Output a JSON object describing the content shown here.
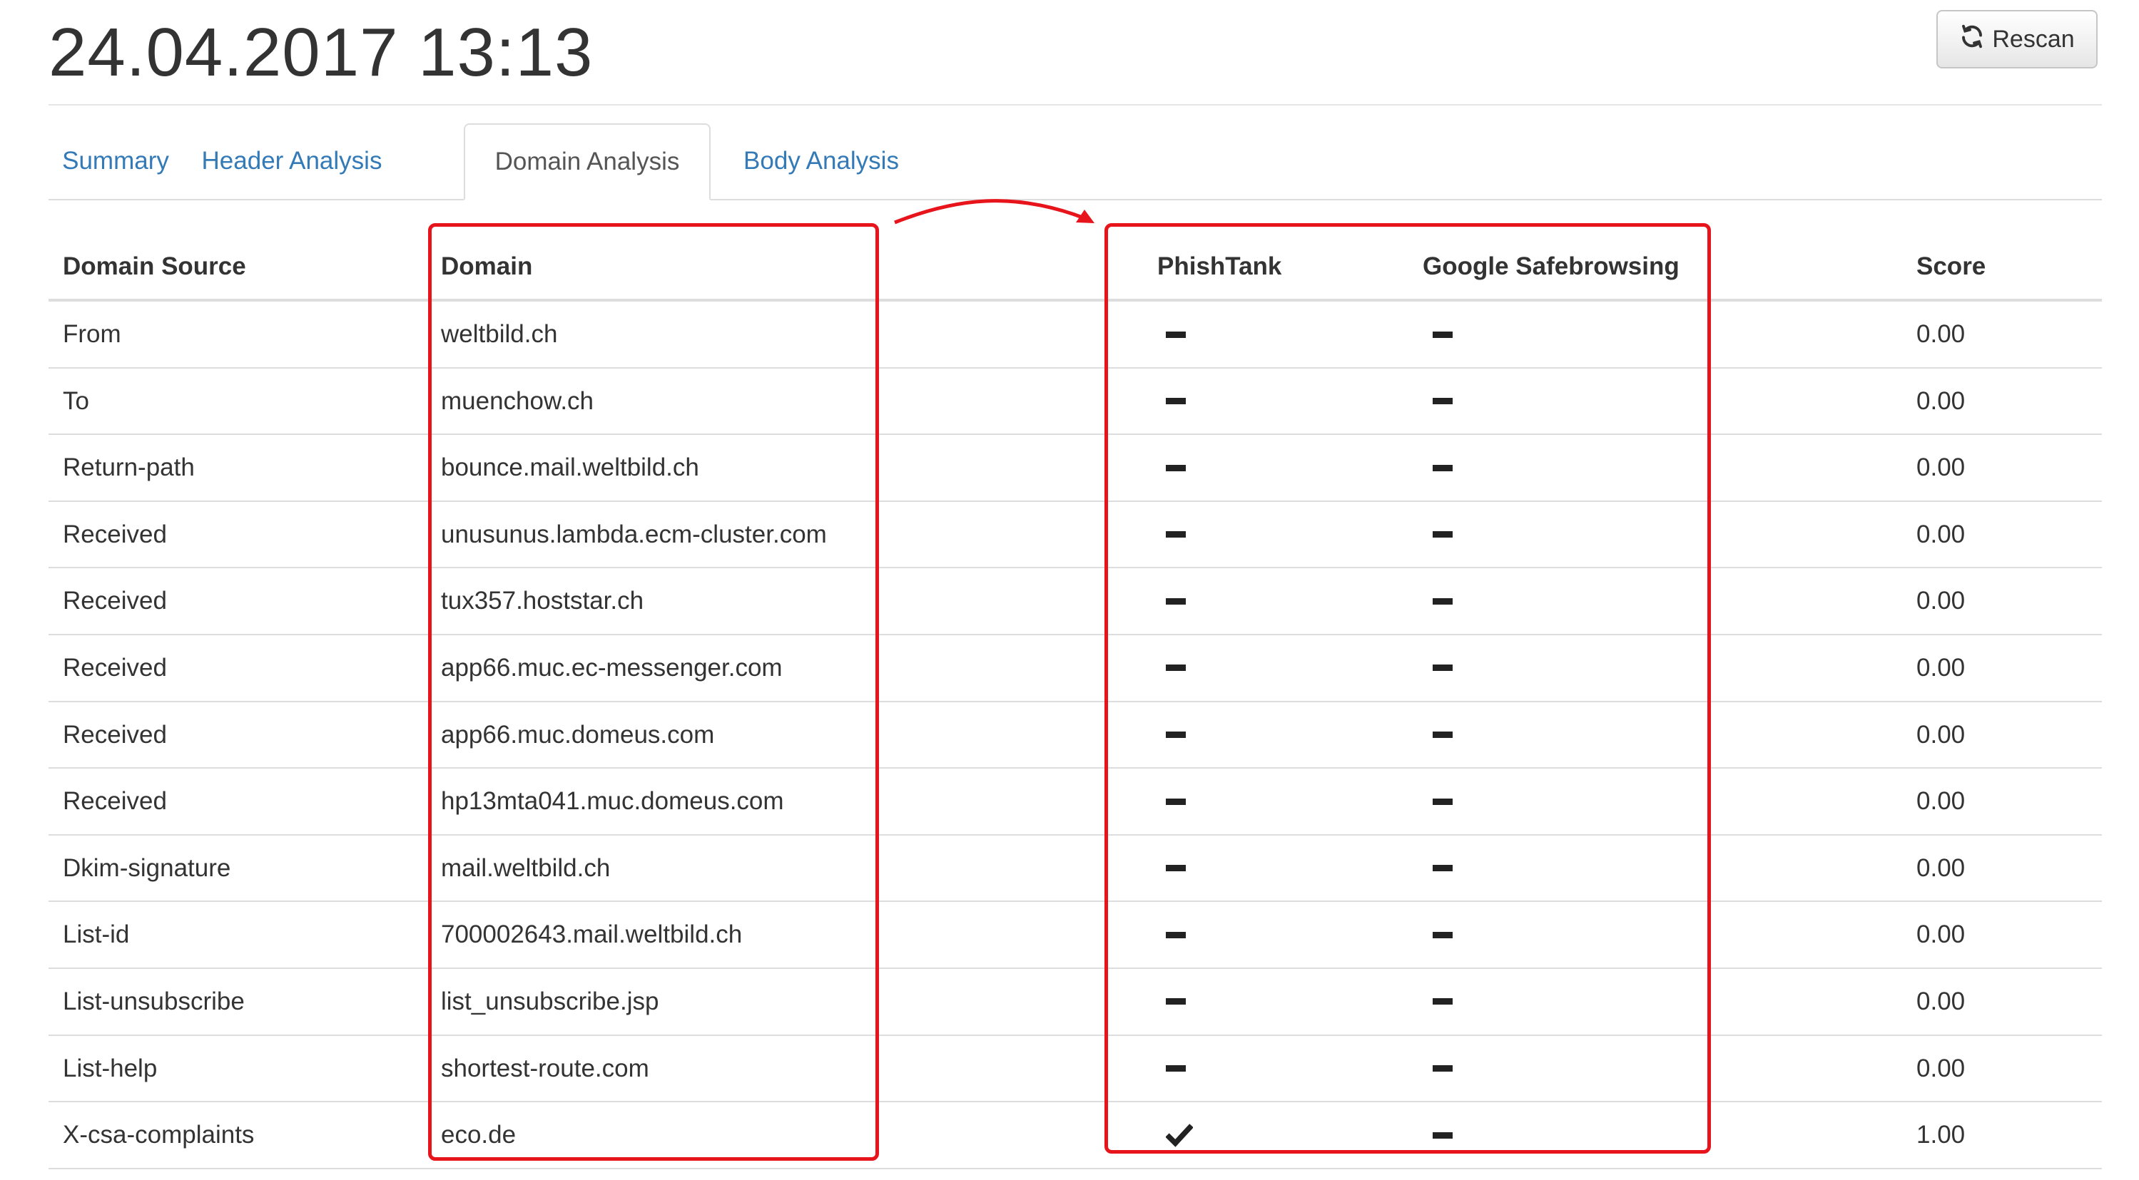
{
  "header": {
    "title": "24.04.2017 13:13",
    "rescan_label": "Rescan"
  },
  "tabs": [
    {
      "label": "Summary",
      "active": false
    },
    {
      "label": "Header Analysis",
      "active": false
    },
    {
      "label": "Domain Analysis",
      "active": true
    },
    {
      "label": "Body Analysis",
      "active": false
    }
  ],
  "table": {
    "columns": [
      "Domain Source",
      "Domain",
      "",
      "PhishTank",
      "Google Safebrowsing",
      "Score"
    ],
    "rows": [
      {
        "source": "From",
        "domain": "weltbild.ch",
        "phishtank": "dash",
        "google": "dash",
        "score": "0.00"
      },
      {
        "source": "To",
        "domain": "muenchow.ch",
        "phishtank": "dash",
        "google": "dash",
        "score": "0.00"
      },
      {
        "source": "Return-path",
        "domain": "bounce.mail.weltbild.ch",
        "phishtank": "dash",
        "google": "dash",
        "score": "0.00"
      },
      {
        "source": "Received",
        "domain": "unusunus.lambda.ecm-cluster.com",
        "phishtank": "dash",
        "google": "dash",
        "score": "0.00"
      },
      {
        "source": "Received",
        "domain": "tux357.hoststar.ch",
        "phishtank": "dash",
        "google": "dash",
        "score": "0.00"
      },
      {
        "source": "Received",
        "domain": "app66.muc.ec-messenger.com",
        "phishtank": "dash",
        "google": "dash",
        "score": "0.00"
      },
      {
        "source": "Received",
        "domain": "app66.muc.domeus.com",
        "phishtank": "dash",
        "google": "dash",
        "score": "0.00"
      },
      {
        "source": "Received",
        "domain": "hp13mta041.muc.domeus.com",
        "phishtank": "dash",
        "google": "dash",
        "score": "0.00"
      },
      {
        "source": "Dkim-signature",
        "domain": "mail.weltbild.ch",
        "phishtank": "dash",
        "google": "dash",
        "score": "0.00"
      },
      {
        "source": "List-id",
        "domain": "700002643.mail.weltbild.ch",
        "phishtank": "dash",
        "google": "dash",
        "score": "0.00"
      },
      {
        "source": "List-unsubscribe",
        "domain": "list_unsubscribe.jsp",
        "phishtank": "dash",
        "google": "dash",
        "score": "0.00"
      },
      {
        "source": "List-help",
        "domain": "shortest-route.com",
        "phishtank": "dash",
        "google": "dash",
        "score": "0.00"
      },
      {
        "source": "X-csa-complaints",
        "domain": "eco.de",
        "phishtank": "check",
        "google": "dash",
        "score": "1.00"
      }
    ]
  },
  "annotations": {
    "box_color": "#e8141b",
    "arrow_color": "#e8141b"
  },
  "colors": {
    "link": "#337ab7",
    "text": "#333333",
    "border": "#dddddd"
  },
  "icons": {
    "rescan": "refresh-icon",
    "dash": "minus-icon",
    "check": "check-icon"
  }
}
